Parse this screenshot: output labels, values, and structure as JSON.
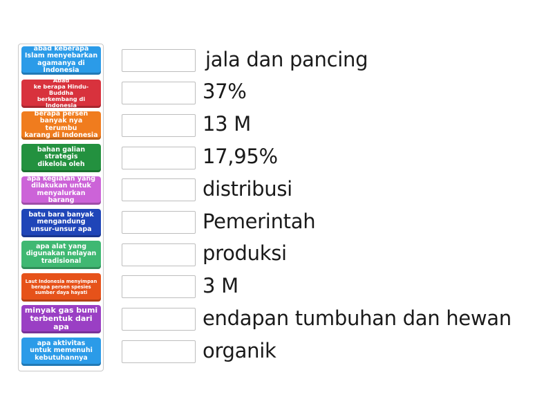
{
  "tiles": [
    {
      "label": "abad keberapa\nIslam menyebarkan\nagamanya di Indonesia",
      "color": "#2b9be8"
    },
    {
      "label": "Abad\nke berapa Hindu-Buddha\nberkembang di Indonesia",
      "color": "#d8323d"
    },
    {
      "label": "berapa persen\nbanyak nya terumbu\nkarang di Indonesia",
      "color": "#f07c1e"
    },
    {
      "label": "bahan galian\nstrategis\ndikelola oleh",
      "color": "#23913f"
    },
    {
      "label": "apa kegiatan yang\ndilakukan untuk\nmenyalurkan barang",
      "color": "#cc63d8"
    },
    {
      "label": "batu bara banyak\nmengandung\nunsur-unsur apa",
      "color": "#1f45b8"
    },
    {
      "label": "apa alat yang\ndigunakan nelayan\ntradisional",
      "color": "#3fb872"
    },
    {
      "label": "Laut Indonesia menyimpan\nberapa persen spesies\nsumber daya hayati",
      "color": "#e6521a"
    },
    {
      "label": "minyak gas bumi\nterbentuk dari apa",
      "color": "#9a3fc4"
    },
    {
      "label": "apa aktivitas\nuntuk memenuhi\nkebutuhannya",
      "color": "#2b9be8"
    }
  ],
  "answers": [
    "jala dan pancing",
    "37%",
    "13 M",
    "17,95%",
    "distribusi",
    "Pemerintah",
    "produksi",
    "3 M",
    "endapan tumbuhan dan hewan",
    "organik"
  ]
}
